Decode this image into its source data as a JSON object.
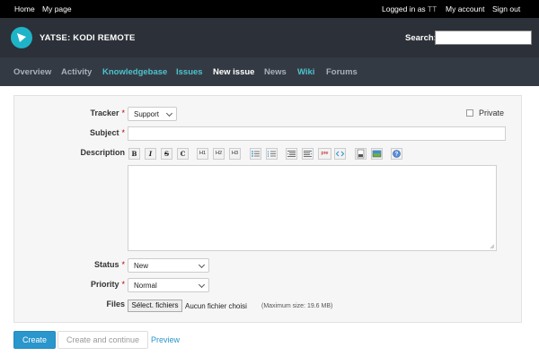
{
  "topmenu": {
    "home": "Home",
    "mypage": "My page",
    "logged_in_prefix": "Logged in as",
    "user": "TT",
    "my_account": "My account",
    "sign_out": "Sign out"
  },
  "header": {
    "project_title": "YATSE: KODI REMOTE",
    "search_label": "Search:",
    "search_value": ""
  },
  "mainnav": {
    "items": [
      "Overview",
      "Activity",
      "Knowledgebase",
      "Issues",
      "New issue",
      "News",
      "Wiki",
      "Forums"
    ],
    "selected": "New issue"
  },
  "form": {
    "tracker_label": "Tracker",
    "tracker_value": "Support",
    "private_label": "Private",
    "subject_label": "Subject",
    "subject_value": "",
    "description_label": "Description",
    "description_value": "",
    "toolbar": [
      "B",
      "I",
      "S",
      "C",
      "H1",
      "H2",
      "H3",
      "ul",
      "ol",
      "left",
      "right",
      "pre",
      "code",
      "img-link",
      "image",
      "help"
    ],
    "status_label": "Status",
    "status_value": "New",
    "priority_label": "Priority",
    "priority_value": "Normal",
    "files_label": "Files",
    "file_button": "Sélect. fichiers",
    "no_file": "Aucun fichier choisi",
    "max_size": "(Maximum size: 19.6 MB)",
    "required_mark": "*"
  },
  "actions": {
    "create": "Create",
    "create_continue": "Create and continue",
    "preview": "Preview"
  },
  "colors": {
    "accent": "#2996cc",
    "teal": "#4cc3cf",
    "header_bg": "#2c3038"
  }
}
